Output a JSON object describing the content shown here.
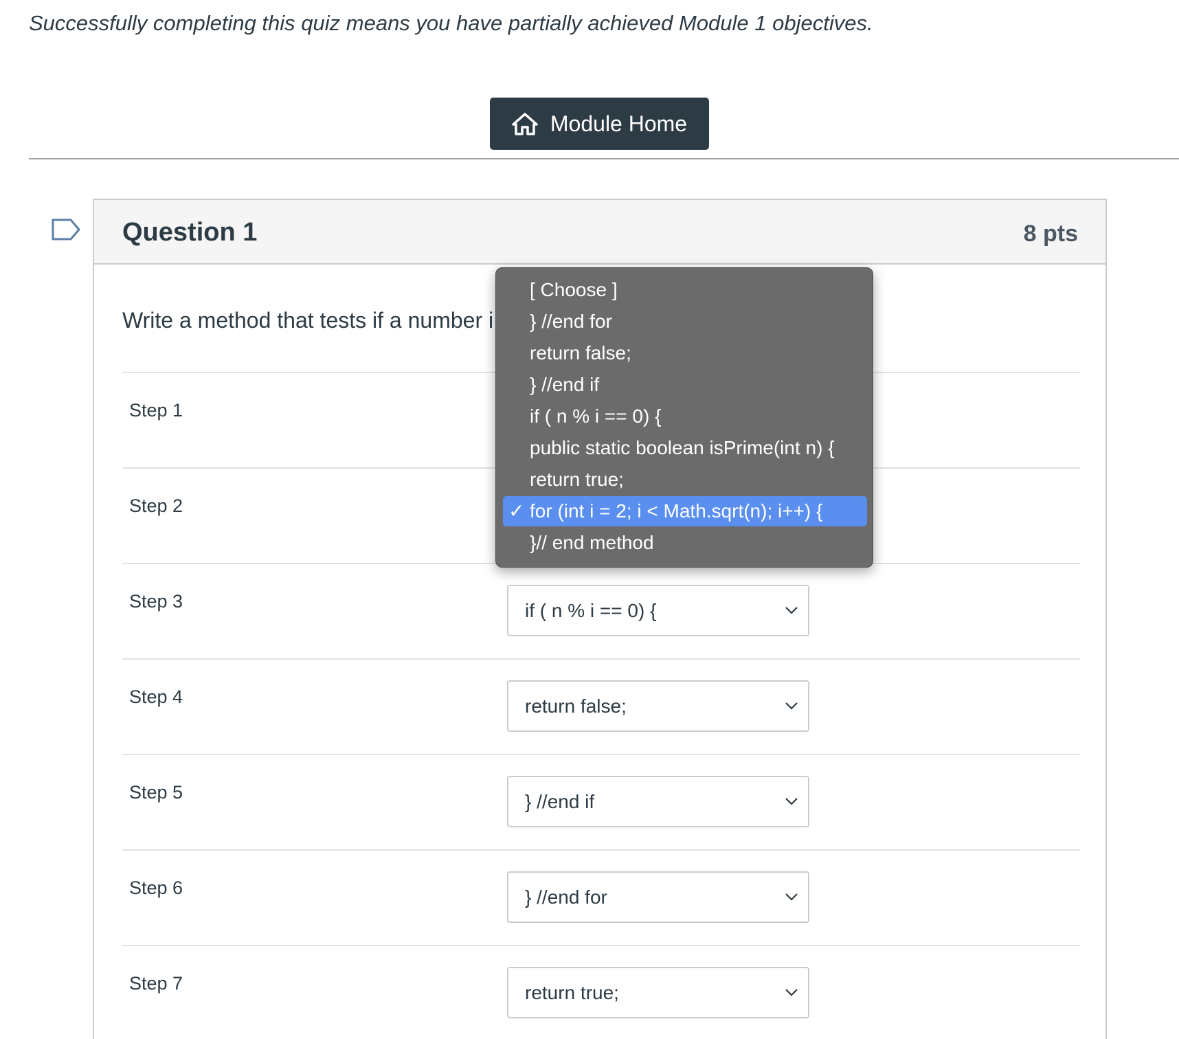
{
  "intro_text": "Successfully completing this quiz means you have partially achieved Module 1 objectives.",
  "module_home_button": {
    "label": "Module Home",
    "icon": "home-icon"
  },
  "question": {
    "title": "Question 1",
    "points": "8 pts",
    "prompt": "Write a method that tests if a number i"
  },
  "steps": [
    {
      "label": "Step 1",
      "value": ""
    },
    {
      "label": "Step 2",
      "value": ""
    },
    {
      "label": "Step 3",
      "value": "if ( n % i == 0) {"
    },
    {
      "label": "Step 4",
      "value": "return false;"
    },
    {
      "label": "Step 5",
      "value": "} //end if"
    },
    {
      "label": "Step 6",
      "value": "} //end for"
    },
    {
      "label": "Step 7",
      "value": "return true;"
    }
  ],
  "dropdown": {
    "selected_check": "✓",
    "options": [
      "[ Choose ]",
      "} //end for",
      "return false;",
      "} //end if",
      "if ( n % i == 0) {",
      "public static boolean isPrime(int n) {",
      "return true;",
      "for (int i = 2; i < Math.sqrt(n); i++) {",
      "}// end method"
    ],
    "selected_index": 7
  },
  "colors": {
    "button_bg": "#2d3b45",
    "dropdown_bg": "#6b6b6b",
    "selected_option_bg": "#5a8ff0",
    "text": "#2d3b45"
  }
}
